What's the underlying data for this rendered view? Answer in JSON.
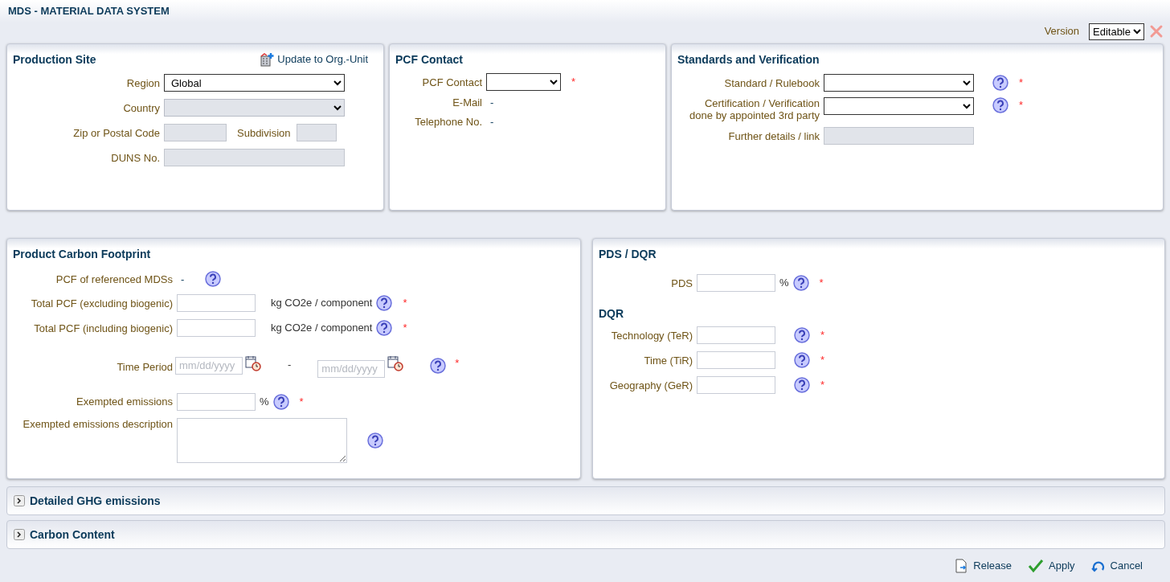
{
  "window": {
    "title": "MDS - MATERIAL DATA SYSTEM"
  },
  "version": {
    "label": "Version",
    "value": "Editable"
  },
  "production_site": {
    "title": "Production Site",
    "action": "Update to Org.-Unit",
    "fields": [
      {
        "kind": "select",
        "label": "Region",
        "value": "Global",
        "disabled": false
      },
      {
        "kind": "select",
        "label": "Country",
        "disabled": true
      },
      {
        "kind": "pair",
        "label": "Zip or Postal Code",
        "disabled": true,
        "second_label": "Subdivision",
        "second_disabled": true
      },
      {
        "kind": "input",
        "label": "DUNS No.",
        "disabled": true
      }
    ]
  },
  "pcf_contact": {
    "title": "PCF Contact",
    "fields": [
      {
        "kind": "select",
        "label": "PCF Contact",
        "disabled": false,
        "required_mark": "*"
      },
      {
        "kind": "text",
        "label": "E-Mail",
        "display": "-"
      },
      {
        "kind": "text",
        "label": "Telephone No.",
        "display": "-"
      }
    ]
  },
  "standards": {
    "title": "Standards and Verification",
    "fields": [
      {
        "kind": "select",
        "label": "Standard / Rulebook",
        "disabled": false,
        "help": true,
        "required_mark": "*"
      },
      {
        "kind": "select",
        "label": "Certification / Verification\ndone by appointed 3rd party",
        "disabled": false,
        "help": true,
        "required_mark": "*"
      },
      {
        "kind": "input",
        "label": "Further details / link",
        "disabled": true
      }
    ]
  },
  "product_carbon_footprint": {
    "title": "Product Carbon Footprint",
    "fields": [
      {
        "kind": "text",
        "label": "PCF of referenced MDSs",
        "display": "-",
        "help": true
      },
      {
        "kind": "input",
        "label": "Total PCF (excluding biogenic)",
        "disabled": false,
        "unit": "kg CO2e / component",
        "help": true,
        "required_mark": "*"
      },
      {
        "kind": "input",
        "label": "Total PCF (including biogenic)",
        "disabled": false,
        "unit": "kg CO2e / component",
        "help": true,
        "required_mark": "*"
      },
      {
        "kind": "date_range",
        "label": "Time Period",
        "placeholder": "mm/dd/yyyy",
        "separator": "-",
        "end_placeholder": "mm/dd/yyyy",
        "help": true,
        "required_mark": "*"
      },
      {
        "kind": "input",
        "label": "Exempted emissions",
        "disabled": false,
        "unit": "%",
        "help": true,
        "required_mark": "*"
      },
      {
        "kind": "textarea",
        "label": "Exempted emissions description",
        "help": true
      }
    ]
  },
  "pds_dqr": {
    "title": "PDS / DQR",
    "fields": [
      {
        "kind": "input",
        "label": "PDS",
        "disabled": false,
        "unit": "%",
        "help": true,
        "required_mark": "*"
      },
      {
        "kind": "heading",
        "label": "DQR"
      },
      {
        "kind": "input",
        "label": "Technology (TeR)",
        "disabled": false,
        "help": true,
        "required_mark": "*"
      },
      {
        "kind": "input",
        "label": "Time (TiR)",
        "disabled": false,
        "help": true,
        "required_mark": "*"
      },
      {
        "kind": "input",
        "label": "Geography (GeR)",
        "disabled": false,
        "help": true,
        "required_mark": "*"
      }
    ]
  },
  "sections": [
    {
      "title": "Detailed GHG emissions",
      "expanded": false
    },
    {
      "title": "Carbon Content",
      "expanded": false
    }
  ],
  "footer_buttons": [
    {
      "kind": "release",
      "label": "Release"
    },
    {
      "kind": "apply",
      "label": "Apply"
    },
    {
      "kind": "cancel",
      "label": "Cancel"
    }
  ]
}
